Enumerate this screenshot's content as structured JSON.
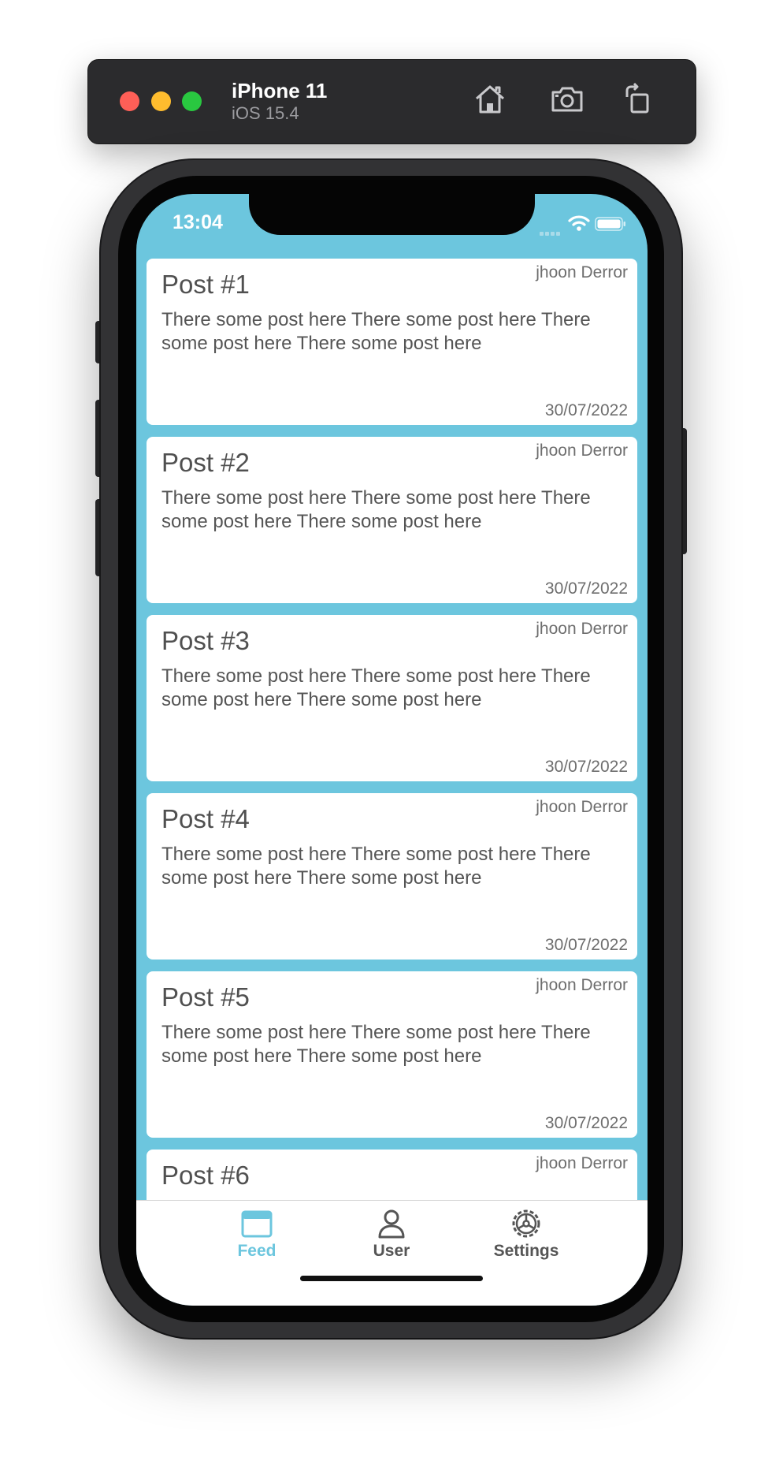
{
  "simulator": {
    "device_name": "iPhone 11",
    "os_version": "iOS 15.4",
    "toolbar_icons": [
      "home-icon",
      "screenshot-camera-icon",
      "rotate-icon"
    ]
  },
  "status_bar": {
    "time": "13:04",
    "icons": [
      "cellular-signal-icon",
      "wifi-icon",
      "battery-icon"
    ]
  },
  "colors": {
    "background": "#6cc6de",
    "card": "#ffffff",
    "active_tab": "#6cc6de",
    "inactive_tab": "#555555"
  },
  "posts": [
    {
      "title": "Post #1",
      "author": "jhoon Derror",
      "body": "There some post here There some post here There some post here There some post here",
      "date": "30/07/2022"
    },
    {
      "title": "Post #2",
      "author": "jhoon Derror",
      "body": "There some post here There some post here There some post here There some post here",
      "date": "30/07/2022"
    },
    {
      "title": "Post #3",
      "author": "jhoon Derror",
      "body": "There some post here There some post here There some post here There some post here",
      "date": "30/07/2022"
    },
    {
      "title": "Post #4",
      "author": "jhoon Derror",
      "body": "There some post here There some post here There some post here There some post here",
      "date": "30/07/2022"
    },
    {
      "title": "Post #5",
      "author": "jhoon Derror",
      "body": "There some post here There some post here There some post here There some post here",
      "date": "30/07/2022"
    },
    {
      "title": "Post #6",
      "author": "jhoon Derror",
      "body": "",
      "date": ""
    }
  ],
  "tabs": [
    {
      "label": "Feed",
      "icon": "feed-window-icon",
      "active": true
    },
    {
      "label": "User",
      "icon": "user-icon",
      "active": false
    },
    {
      "label": "Settings",
      "icon": "settings-gear-icon",
      "active": false
    }
  ]
}
